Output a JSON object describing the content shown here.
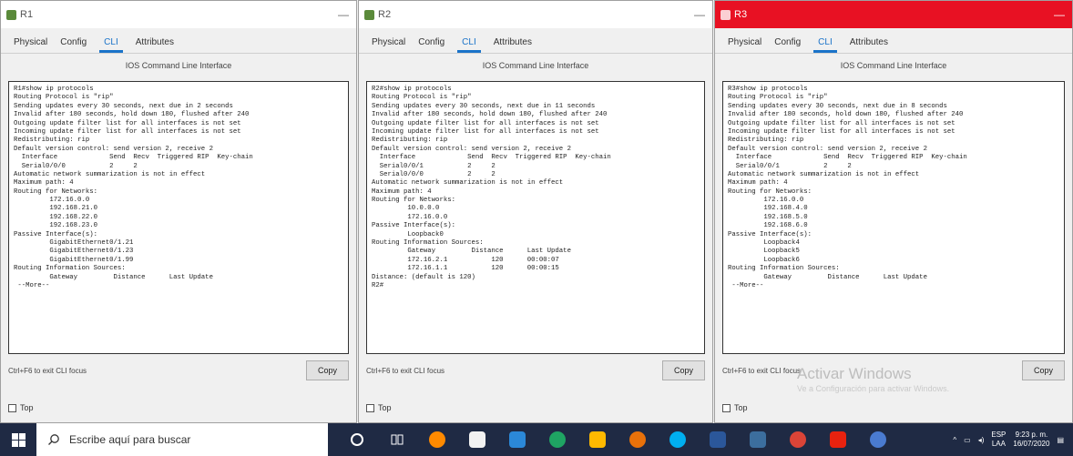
{
  "windows": [
    {
      "title": "R1",
      "tabs": [
        "Physical",
        "Config",
        "CLI",
        "Attributes"
      ],
      "active_tab": "CLI",
      "ios_title": "IOS Command Line Interface",
      "terminal_lines": [
        "R1#show ip protocols",
        "Routing Protocol is \"rip\"",
        "Sending updates every 30 seconds, next due in 2 seconds",
        "Invalid after 180 seconds, hold down 180, flushed after 240",
        "Outgoing update filter list for all interfaces is not set",
        "Incoming update filter list for all interfaces is not set",
        "Redistributing: rip",
        "Default version control: send version 2, receive 2",
        "  Interface             Send  Recv  Triggered RIP  Key-chain",
        "  Serial0/0/0           2     2",
        "Automatic network summarization is not in effect",
        "Maximum path: 4",
        "Routing for Networks:",
        "         172.16.0.0",
        "         192.168.21.0",
        "         192.168.22.0",
        "         192.168.23.0",
        "Passive Interface(s):",
        "         GigabitEthernet0/1.21",
        "         GigabitEthernet0/1.23",
        "         GigabitEthernet0/1.99",
        "Routing Information Sources:",
        "         Gateway         Distance      Last Update",
        " --More--"
      ],
      "exit_hint": "Ctrl+F6 to exit CLI focus",
      "copy_label": "Copy",
      "top_label": "Top"
    },
    {
      "title": "R2",
      "tabs": [
        "Physical",
        "Config",
        "CLI",
        "Attributes"
      ],
      "active_tab": "CLI",
      "ios_title": "IOS Command Line Interface",
      "terminal_lines": [
        "R2#show ip protocols",
        "Routing Protocol is \"rip\"",
        "Sending updates every 30 seconds, next due in 11 seconds",
        "Invalid after 180 seconds, hold down 180, flushed after 240",
        "Outgoing update filter list for all interfaces is not set",
        "Incoming update filter list for all interfaces is not set",
        "Redistributing: rip",
        "Default version control: send version 2, receive 2",
        "  Interface             Send  Recv  Triggered RIP  Key-chain",
        "  Serial0/0/1           2     2",
        "  Serial0/0/0           2     2",
        "Automatic network summarization is not in effect",
        "Maximum path: 4",
        "Routing for Networks:",
        "         10.0.0.0",
        "         172.16.0.0",
        "Passive Interface(s):",
        "         Loopback0",
        "Routing Information Sources:",
        "         Gateway         Distance      Last Update",
        "         172.16.2.1           120      00:00:07",
        "         172.16.1.1           120      00:00:15",
        "Distance: (default is 120)",
        "R2#"
      ],
      "exit_hint": "Ctrl+F6 to exit CLI focus",
      "copy_label": "Copy",
      "top_label": "Top"
    },
    {
      "title": "R3",
      "tabs": [
        "Physical",
        "Config",
        "CLI",
        "Attributes"
      ],
      "active_tab": "CLI",
      "ios_title": "IOS Command Line Interface",
      "terminal_lines": [
        "R3#show ip protocols",
        "Routing Protocol is \"rip\"",
        "Sending updates every 30 seconds, next due in 8 seconds",
        "Invalid after 180 seconds, hold down 180, flushed after 240",
        "Outgoing update filter list for all interfaces is not set",
        "Incoming update filter list for all interfaces is not set",
        "Redistributing: rip",
        "Default version control: send version 2, receive 2",
        "  Interface             Send  Recv  Triggered RIP  Key-chain",
        "  Serial0/0/1           2     2",
        "Automatic network summarization is not in effect",
        "Maximum path: 4",
        "Routing for Networks:",
        "         172.16.0.0",
        "         192.168.4.0",
        "         192.168.5.0",
        "         192.168.6.0",
        "Passive Interface(s):",
        "         Loopback4",
        "         Loopback5",
        "         Loopback6",
        "Routing Information Sources:",
        "         Gateway         Distance      Last Update",
        " --More--"
      ],
      "exit_hint": "Ctrl+F6 to exit CLI focus",
      "copy_label": "Copy",
      "top_label": "Top"
    }
  ],
  "activation": {
    "title": "Activar Windows",
    "subtitle": "Ve a Configuración para activar Windows."
  },
  "taskbar": {
    "search_placeholder": "Escribe aquí para buscar",
    "language_top": "ESP",
    "language_bottom": "LAA",
    "time": "9:23 p. m.",
    "date": "16/07/2020",
    "apps": [
      "cortana-icon",
      "task-view-icon",
      "firefox-icon",
      "store-icon",
      "mail-icon",
      "chrome-icon",
      "files-icon",
      "media-icon",
      "skype-icon",
      "word-icon",
      "packet-tracer-icon",
      "chrome-alt-icon",
      "pdf-icon",
      "vlc-icon"
    ]
  },
  "colors": {
    "active_title_bar": "#e81123",
    "tab_accent": "#1a73c9",
    "taskbar": "#1f2a44"
  }
}
